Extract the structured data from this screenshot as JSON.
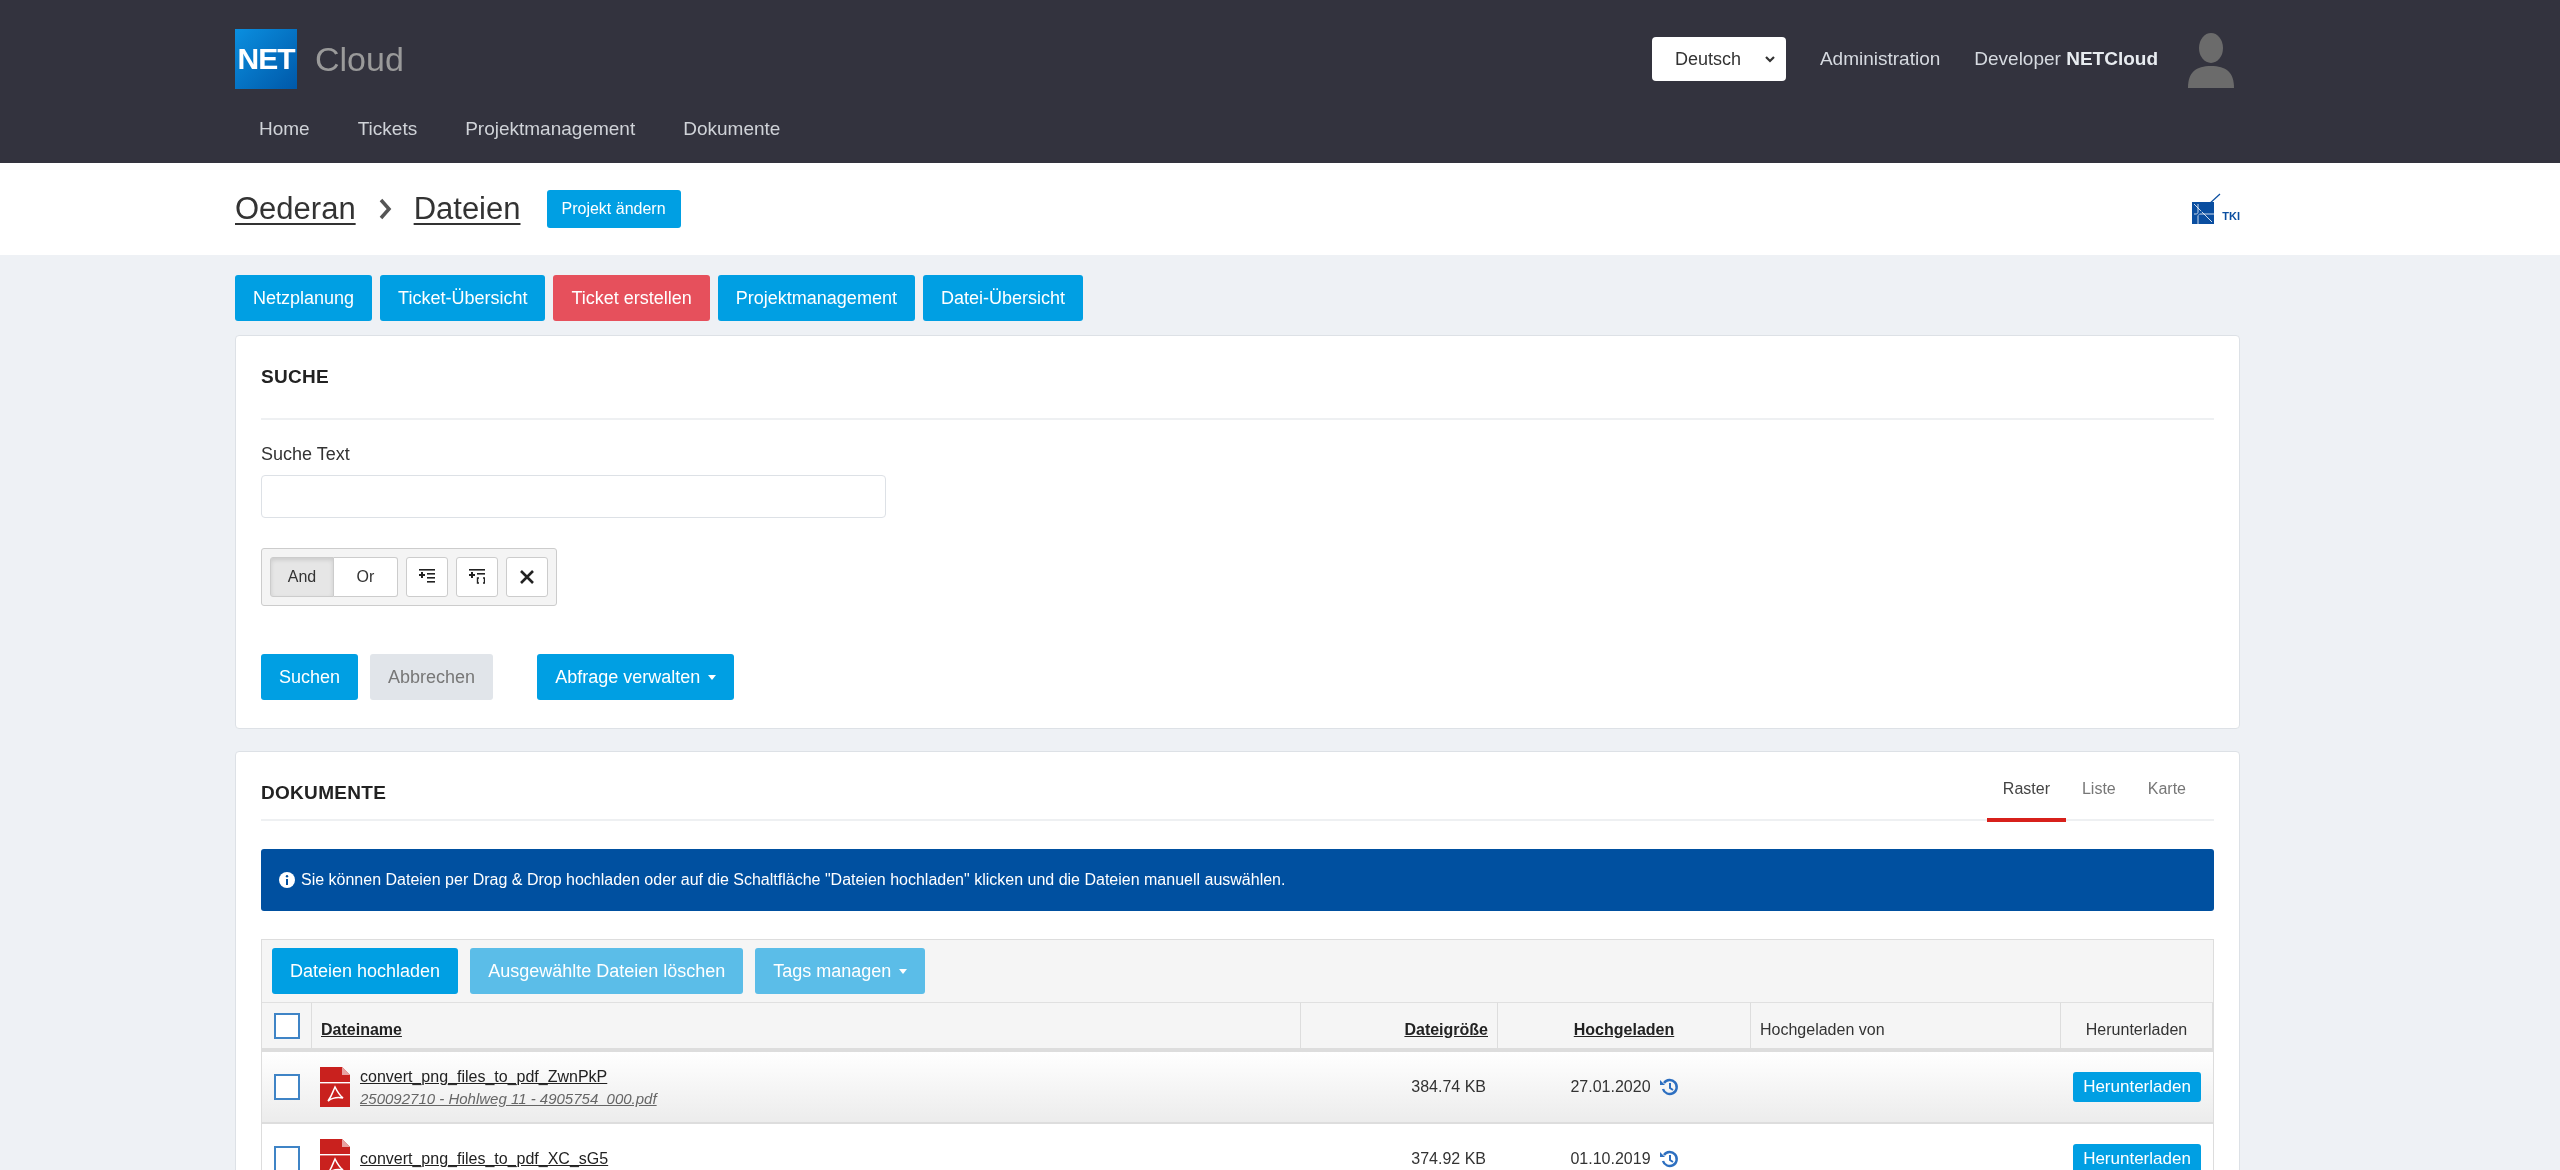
{
  "header": {
    "logo_mark": "NET",
    "logo_name": "Cloud",
    "language": "Deutsch",
    "admin_link": "Administration",
    "user": "Developer **NETCloud**"
  },
  "nav": [
    {
      "label": "Home"
    },
    {
      "label": "Tickets"
    },
    {
      "label": "Projektmanagement"
    },
    {
      "label": "Dokumente"
    }
  ],
  "breadcrumb": [
    "Oederan",
    "Dateien"
  ],
  "project_button": "Projekt ändern",
  "brand_logo_text": "TKI",
  "action_buttons": [
    {
      "label": "Netzplanung",
      "kind": "primary"
    },
    {
      "label": "Ticket-Übersicht",
      "kind": "primary"
    },
    {
      "label": "Ticket erstellen",
      "kind": "danger"
    },
    {
      "label": "Projektmanagement",
      "kind": "primary"
    },
    {
      "label": "Datei-Übersicht",
      "kind": "primary"
    }
  ],
  "search": {
    "title": "SUCHE",
    "field_label": "Suche Text",
    "logic": [
      {
        "label": "And",
        "selected": true
      },
      {
        "label": "Or",
        "selected": false
      }
    ],
    "tools": [
      {
        "kind": "add-rule"
      },
      {
        "kind": "add-group"
      },
      {
        "kind": "clear"
      }
    ],
    "buttons": [
      {
        "label": "Suchen",
        "kind": "primary"
      },
      {
        "label": "Abbrechen",
        "kind": "disabled"
      },
      {
        "label": "Abfrage verwalten",
        "kind": "dropdown"
      }
    ]
  },
  "documents": {
    "title": "DOKUMENTE",
    "views": [
      {
        "label": "Raster",
        "selected": true
      },
      {
        "label": "Liste",
        "selected": false
      },
      {
        "label": "Karte",
        "selected": false
      }
    ],
    "info": "Sie können Dateien per Drag & Drop hochladen oder auf die Schaltfläche \"Dateien hochladen\" klicken und die Dateien manuell auswählen.",
    "toolbar": [
      {
        "label": "Dateien hochladen",
        "kind": "primary"
      },
      {
        "label": "Ausgewählte Dateien löschen",
        "kind": "light"
      },
      {
        "label": "Tags managen",
        "kind": "light-dropdown"
      }
    ],
    "columns": [
      {
        "label": "Dateiname",
        "sortable": true
      },
      {
        "label": "Dateigröße",
        "sortable": true
      },
      {
        "label": "Hochgeladen",
        "sortable": true
      },
      {
        "label": "Hochgeladen von",
        "sortable": false
      },
      {
        "label": "Herunterladen",
        "sortable": false
      }
    ],
    "all_checked": false,
    "rows": [
      {
        "checked": false,
        "name": "convert_png_files_to_pdf_ZwnPkP",
        "file": "250092710 - Hohlweg 11 - 4905754_000.pdf",
        "size": "384.74 KB",
        "uploaded": "27.01.2020",
        "download": "Herunterladen"
      },
      {
        "checked": false,
        "name": "convert_png_files_to_pdf_XC_sG5",
        "size": "374.92 KB",
        "uploaded": "01.10.2019",
        "download": "Herunterladen"
      }
    ]
  }
}
